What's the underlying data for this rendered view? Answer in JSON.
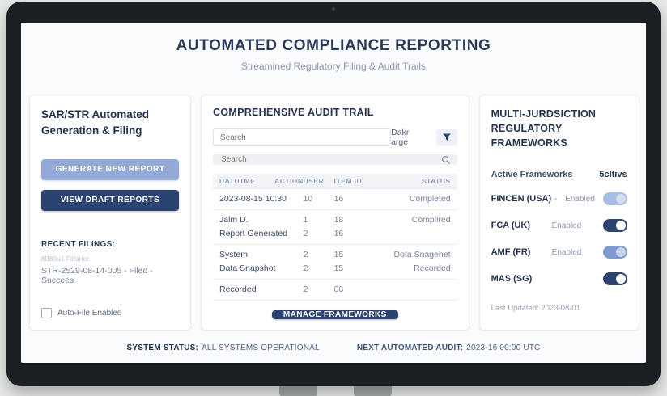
{
  "header": {
    "title": "AUTOMATED COMPLIANCE REPORTING",
    "subtitle": "Streamined Regulatory Filing & Audit Trails"
  },
  "left_panel": {
    "title": "SAR/STR Automated Generation & Filing",
    "generate_button": "GENERATE NEW REPORT",
    "drafts_button": "VIEW DRAFT REPORTS",
    "recent_heading": "RECENT FILINGS:",
    "recent_note": "8080u1 Fil/anet",
    "recent_entry": "STR-2529-08-14-005 - Filed - Succees",
    "autofile_label": "Auto-File Enabled",
    "autofile_checked": false
  },
  "audit_panel": {
    "title": "COMPREHENSIVE AUDIT TRAIL",
    "search_placeholder": "Search",
    "date_range_label": "Dakr arge",
    "search2_placeholder": "Search",
    "table": {
      "headers": {
        "datetime": "DATUTME",
        "action": "ACTION",
        "user": "USER",
        "item": "ITEM ID",
        "status": "STATUS"
      },
      "rows": [
        {
          "c1": [
            "2023-08-15 10:30"
          ],
          "user": [
            "10"
          ],
          "item": [
            "16"
          ],
          "status": [
            "Completed"
          ]
        },
        {
          "c1": [
            "Jalm D.",
            "Report Generated"
          ],
          "user": [
            "1",
            "2"
          ],
          "item": [
            "18",
            "16"
          ],
          "status": [
            "Complired",
            ""
          ]
        },
        {
          "c1": [
            "System",
            "Data Snapshot"
          ],
          "user": [
            "2",
            "2"
          ],
          "item": [
            "15",
            "15"
          ],
          "status": [
            "Dota Snagehet",
            "Recorded"
          ]
        },
        {
          "c1": [
            "Recorded"
          ],
          "user": [
            "2"
          ],
          "item": [
            "08"
          ],
          "status": [
            ""
          ]
        }
      ]
    },
    "manage_button": "MANAGE FRAMEWORKS"
  },
  "frameworks_panel": {
    "title": "MULTI-JURDSICTION REGULATORY FRAMEWORKS",
    "active_label": "Active Frameworks",
    "active_value": "5cltivs",
    "items": [
      {
        "name": "FINCEN (USA)",
        "sep": "-",
        "status": "Enabled",
        "toggle_on": true
      },
      {
        "name": "FCA (UK)",
        "sep": "",
        "status": "Enabled",
        "toggle_on": true
      },
      {
        "name": "AMF (FR)",
        "sep": "",
        "status": "Enabled",
        "toggle_on": true
      },
      {
        "name": "MAS (SG)",
        "sep": "",
        "status": "",
        "toggle_on": true
      }
    ],
    "last_updated": "Last Updated: 2023-08-01"
  },
  "status_bar": {
    "system_label": "SYSTEM STATUS:",
    "system_value": "ALL SYSTEMS OPERATIONAL",
    "audit_label": "NEXT AUTOMATED AUDIT:",
    "audit_value": "2023-16 00:00 UTC"
  },
  "colors": {
    "accent_dark": "#2c4270",
    "accent_light": "#93aad9",
    "navy_text": "#24324e",
    "muted_text": "#8a94a6"
  }
}
